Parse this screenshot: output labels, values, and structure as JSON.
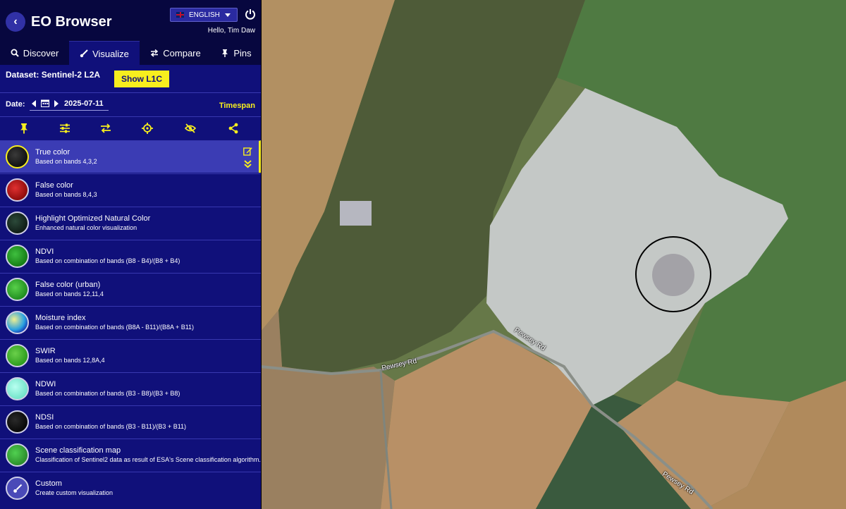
{
  "app": {
    "title": "EO Browser",
    "language": "ENGLISH",
    "greeting": "Hello, Tim Daw"
  },
  "tabs": [
    {
      "label": "Discover",
      "icon": "search-icon"
    },
    {
      "label": "Visualize",
      "icon": "brush-icon"
    },
    {
      "label": "Compare",
      "icon": "compare-icon"
    },
    {
      "label": "Pins",
      "icon": "pin-icon"
    }
  ],
  "dataset": {
    "label": "Dataset:",
    "name": "Sentinel-2 L2A",
    "toggle_label": "Show L1C"
  },
  "date": {
    "label": "Date:",
    "value": "2025-07-11",
    "timespan_label": "Timespan"
  },
  "toolbar": [
    "pin-icon",
    "settings-sliders-icon",
    "compare-arrows-icon",
    "crosshair-icon",
    "hide-eye-icon",
    "share-icon"
  ],
  "layers": [
    {
      "name": "True color",
      "desc": "Based on bands 4,3,2",
      "selected": true
    },
    {
      "name": "False color",
      "desc": "Based on bands 8,4,3"
    },
    {
      "name": "Highlight Optimized Natural Color",
      "desc": "Enhanced natural color visualization"
    },
    {
      "name": "NDVI",
      "desc": "Based on combination of bands (B8 - B4)/(B8 + B4)"
    },
    {
      "name": "False color (urban)",
      "desc": "Based on bands 12,11,4"
    },
    {
      "name": "Moisture index",
      "desc": "Based on combination of bands (B8A - B11)/(B8A + B11)"
    },
    {
      "name": "SWIR",
      "desc": "Based on bands 12,8A,4"
    },
    {
      "name": "NDWI",
      "desc": "Based on combination of bands (B3 - B8)/(B3 + B8)"
    },
    {
      "name": "NDSI",
      "desc": "Based on combination of bands (B3 - B11)/(B3 + B11)"
    },
    {
      "name": "Scene classification map",
      "desc": "Classification of Sentinel2 data as result of ESA's Scene classification algorithm."
    },
    {
      "name": "Custom",
      "desc": "Create custom visualization"
    }
  ],
  "map": {
    "road_labels": [
      "Pewsey Rd",
      "Pewsey Rd",
      "Pewsey Rd"
    ]
  },
  "colors": {
    "panel": "#10107a",
    "header": "#07073f",
    "accent": "#f7ee1e",
    "selected": "#3b3cb4"
  }
}
